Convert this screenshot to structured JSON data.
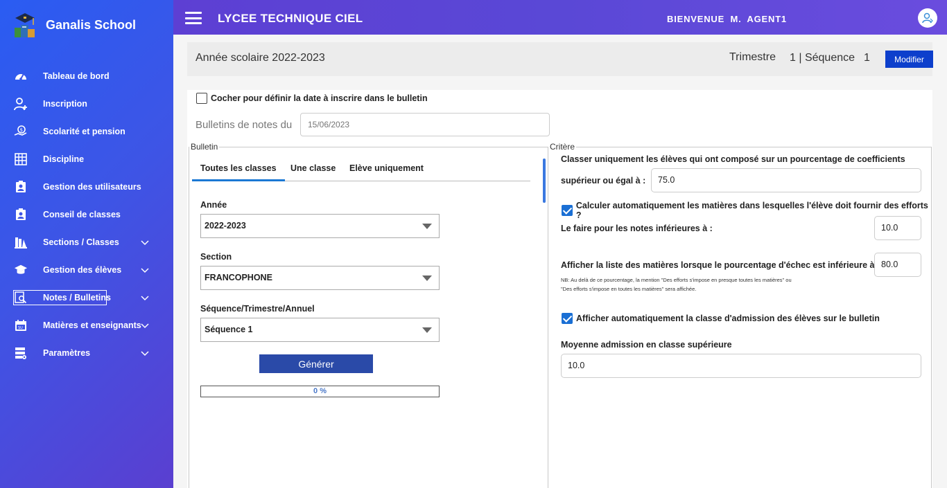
{
  "sidebar": {
    "brand": "Ganalis School",
    "items": [
      {
        "label": "Tableau de bord",
        "icon": "dashboard-icon"
      },
      {
        "label": "Inscription",
        "icon": "user-add-icon"
      },
      {
        "label": "Scolarité et pension",
        "icon": "money-hand-icon"
      },
      {
        "label": "Discipline",
        "icon": "calculator-icon"
      },
      {
        "label": "Gestion des utilisateurs",
        "icon": "id-badge-icon"
      },
      {
        "label": "Conseil de classes",
        "icon": "clipboard-user-icon"
      },
      {
        "label": "Sections / Classes",
        "icon": "school-building-icon"
      },
      {
        "label": "Gestion des élèves",
        "icon": "graduation-cap-icon"
      },
      {
        "label": "Notes / Bulletins",
        "icon": "search-doc-icon"
      },
      {
        "label": "Matières et enseignants",
        "icon": "calendar-icon"
      },
      {
        "label": "Paramètres",
        "icon": "settings-stack-icon"
      }
    ]
  },
  "topbar": {
    "school": "LYCEE TECHNIQUE CIEL",
    "welcome": "BIENVENUE  M.  AGENT1"
  },
  "yearbar": {
    "year": "Année scolaire 2022-2023",
    "trimestre_label": "Trimestre",
    "sequence_text": "1 | Séquence",
    "sequence_num": "1",
    "modify_button": "Modifier"
  },
  "date_section": {
    "checkbox_label": "Cocher pour définir la date à inscrire dans le bulletin",
    "date_label": "Bulletins de notes du",
    "date_placeholder": "15/06/2023"
  },
  "bulletin": {
    "legend": "Bulletin",
    "tabs": [
      "Toutes les classes",
      "Une classe",
      "Elève uniquement"
    ],
    "annee_label": "Année",
    "annee_value": "2022-2023",
    "section_label": "Section",
    "section_value": "FRANCOPHONE",
    "periode_label": "Séquence/Trimestre/Annuel",
    "periode_value": "Séquence 1",
    "generate_button": "Générer",
    "progress_text": "0 %",
    "progress": 0
  },
  "critere": {
    "legend": "Critère",
    "classer_line1": "Classer uniquement les élèves qui ont composé sur un pourcentage de coefficients",
    "classer_line2": "supérieur ou égal à :",
    "classer_value": "75.0",
    "calc_label": "Calculer automatiquement les matières dans lesquelles l'élève doit fournir des efforts ?",
    "faire_label": "Le faire pour les notes inférieures à :",
    "faire_value": "10.0",
    "afficher_label": "Afficher la liste des matières lorsque le pourcentage d'échec est inférieure  à",
    "afficher_value": "80.0",
    "nb_line1": "NB: Au delà de ce pourcentage, la mention \"Des efforts s'impose en presque toutes les matières\" ou",
    "nb_line2": "\"Des efforts s'impose en toutes les matières\" sera affichée.",
    "admission_chk_label": "Afficher automatiquement la classe d'admission des élèves sur le bulletin",
    "moyenne_label": "Moyenne admission en classe supérieure",
    "moyenne_value": "10.0"
  }
}
